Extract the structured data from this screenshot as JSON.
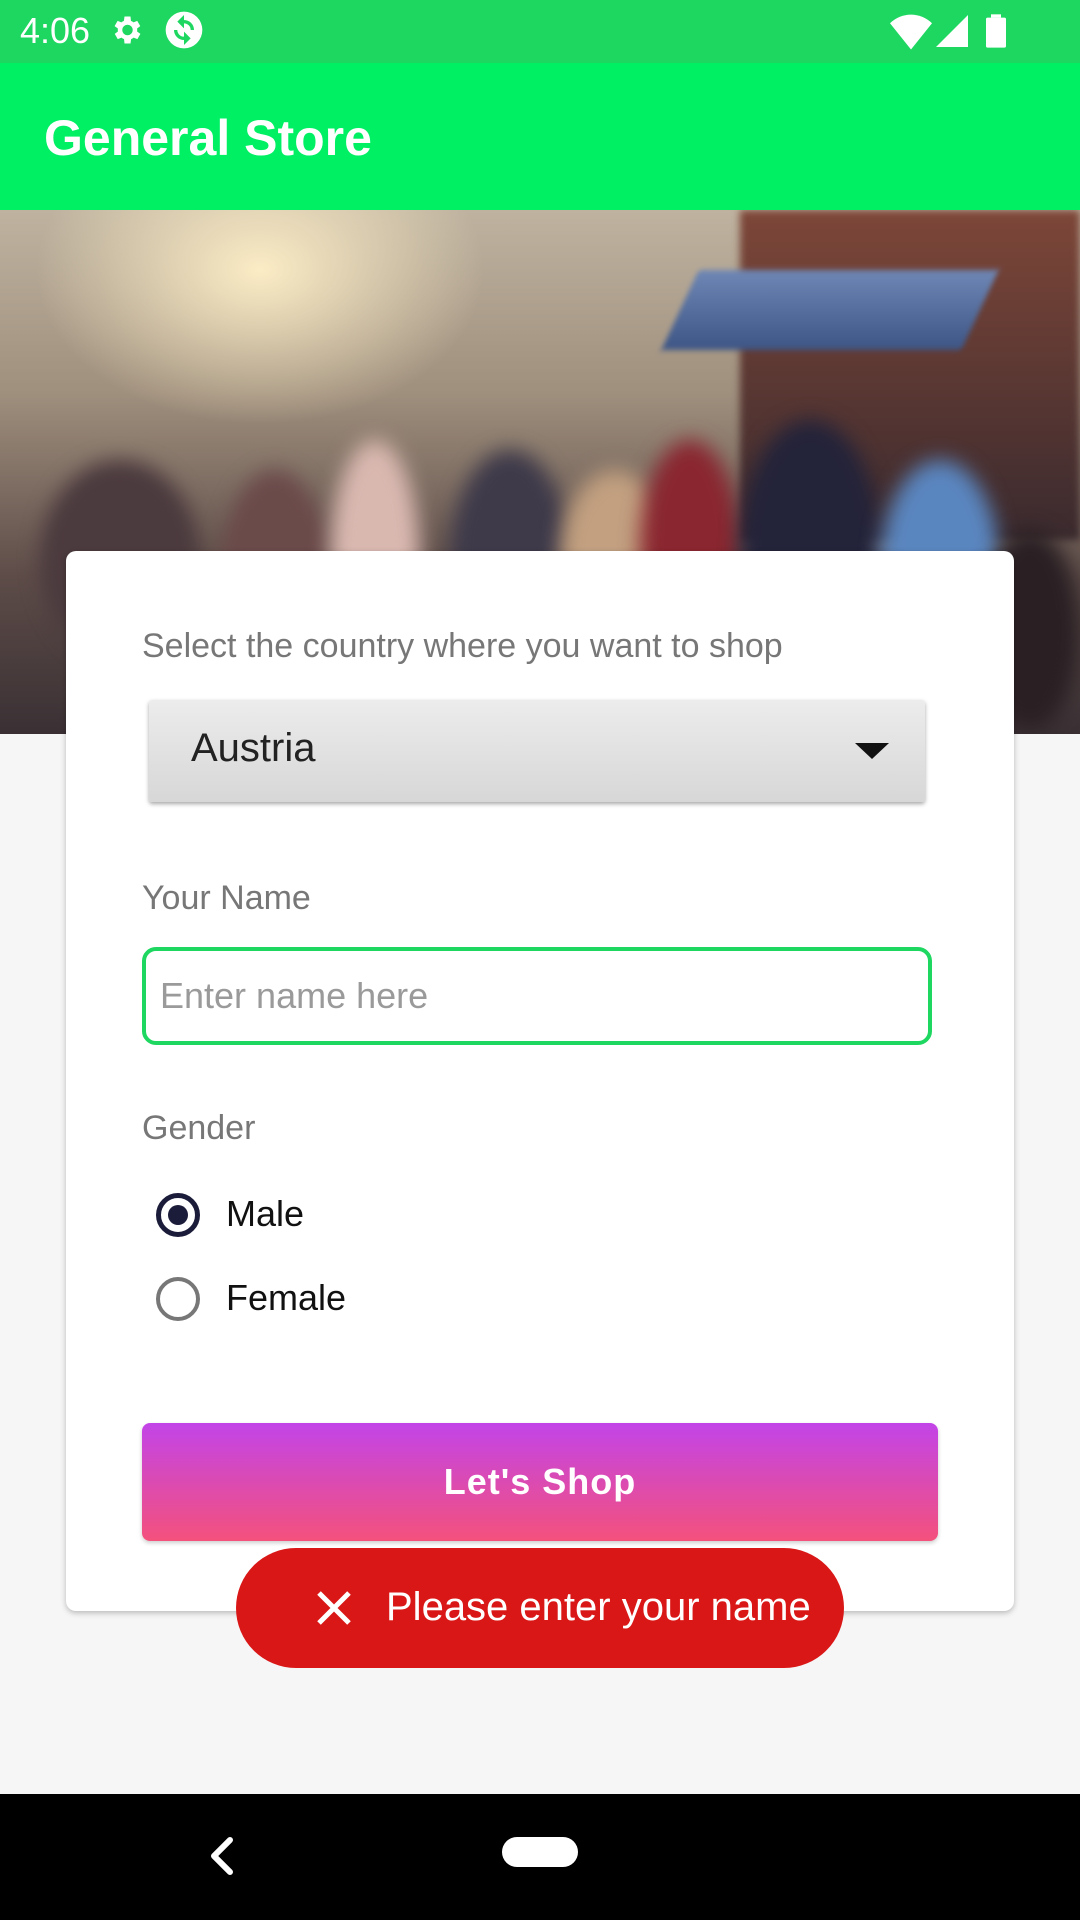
{
  "status_bar": {
    "time": "4:06",
    "icons": [
      "gear-icon",
      "sync-icon",
      "wifi-icon",
      "signal-icon",
      "battery-icon"
    ]
  },
  "app_bar": {
    "title": "General Store",
    "color": "#00f064"
  },
  "form": {
    "country_label": "Select the country where you want to shop",
    "country_selected": "Austria",
    "name_label": "Your Name",
    "name_value": "",
    "name_placeholder": "Enter name here",
    "gender_label": "Gender",
    "gender_options": [
      {
        "label": "Male",
        "selected": true
      },
      {
        "label": "Female",
        "selected": false
      }
    ],
    "shop_button": "Let's  Shop"
  },
  "toast": {
    "message": "Please enter your name",
    "icon": "close-icon",
    "color": "#da1717"
  },
  "nav_bar": {
    "icons": [
      "back-icon",
      "home-pill"
    ]
  }
}
